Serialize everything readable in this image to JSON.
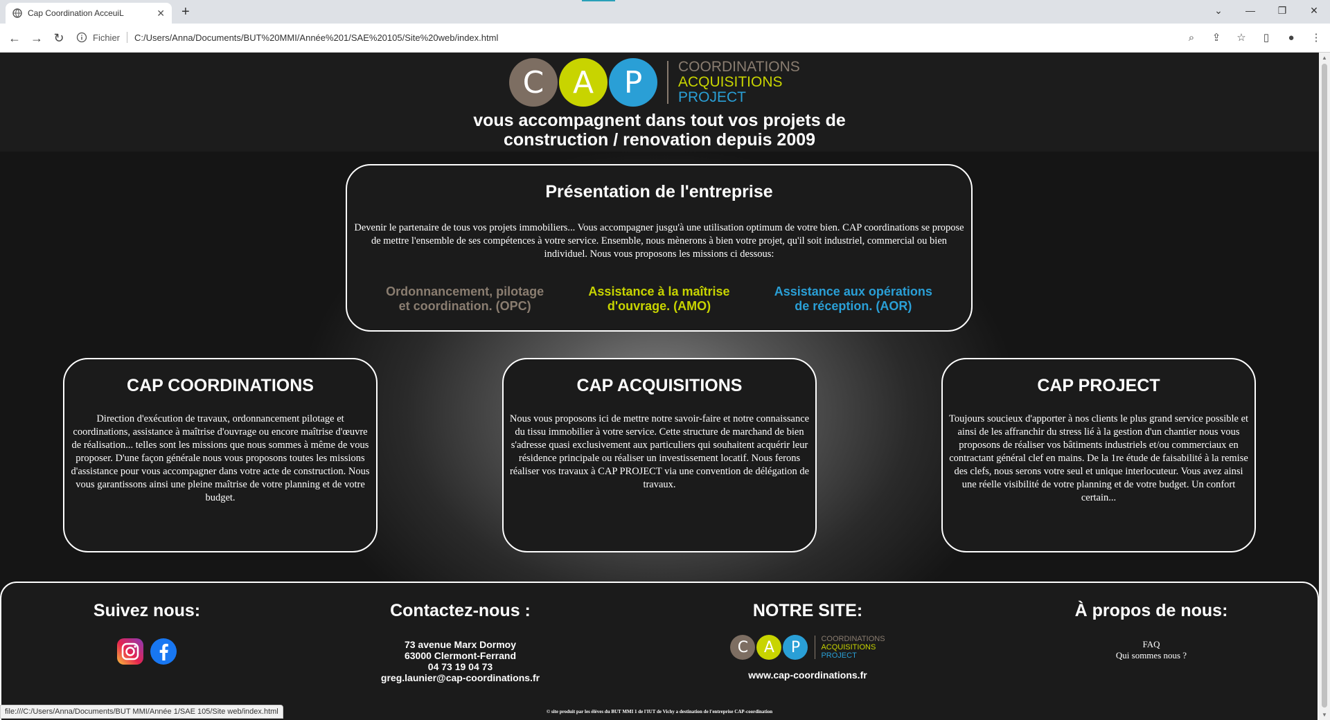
{
  "browser": {
    "tab_title": "Cap Coordination AcceuiL",
    "new_tab": "+",
    "url_scheme": "Fichier",
    "url": "C:/Users/Anna/Documents/BUT%20MMI/Année%201/SAE%20105/Site%20web/index.html",
    "status_url": "file:///C:/Users/Anna/Documents/BUT MMI/Année 1/SAE 105/Site web/index.html"
  },
  "header": {
    "logo_letters": [
      "C",
      "A",
      "P"
    ],
    "logo_words": [
      "COORDINATIONS",
      "ACQUISITIONS",
      "PROJECT"
    ],
    "tagline_line1": "vous accompagnent dans tout vos projets de",
    "tagline_line2": "construction / renovation depuis 2009"
  },
  "presentation": {
    "title": "Présentation de l'entreprise",
    "text": "Devenir le partenaire de tous vos projets immobiliers... Vous accompagner jusgu'à une utilisation optimum de votre bien. CAP coordinations se propose de mettre l'ensemble de ses compétences à votre service. Ensemble, nous mènerons à bien votre projet, qu'il soit industriel, commercial ou bien individuel. Nous vous proposons les missions ci dessous:",
    "missions": [
      "Ordonnancement, pilotage et coordination. (OPC)",
      "Assistance à la maîtrise d'ouvrage. (AMO)",
      "Assistance aux opérations de réception. (AOR)"
    ]
  },
  "cards": [
    {
      "title": "CAP COORDINATIONS",
      "text": "Direction d'exécution de travaux, ordonnancement pilotage et coordinations, assistance à maîtrise d'ouvrage ou encore maîtrise d'œuvre de réalisation... telles sont les missions que nous sommes à même de vous proposer. D'une façon générale nous vous proposons toutes les missions d'assistance pour vous accompagner dans votre acte de construction. Nous vous garantissons ainsi une pleine maîtrise de votre planning et de votre budget."
    },
    {
      "title": "CAP ACQUISITIONS",
      "text": "Nous vous proposons ici de mettre notre savoir-faire et notre connaissance du tissu immobilier à votre service. Cette structure de marchand de bien s'adresse quasi exclusivement aux particuliers qui souhaitent acquérir leur résidence principale ou réaliser un investissement locatif. Nous ferons réaliser vos travaux à CAP PROJECT via une convention de délégation de travaux."
    },
    {
      "title": "CAP PROJECT",
      "text": "Toujours soucieux d'apporter à nos clients le plus grand service possible et ainsi de les affranchir du stress lié à la gestion d'un chantier nous vous proposons de réaliser vos bâtiments industriels et/ou commerciaux en contractant général clef en mains. De la 1re étude de faisabilité à la remise des clefs, nous serons votre seul et unique interlocuteur. Vous avez ainsi une réelle visibilité de votre planning et de votre budget. Un confort certain..."
    }
  ],
  "footer": {
    "follow_title": "Suivez nous:",
    "contact_title": "Contactez-nous :",
    "contact_lines": [
      "73 avenue Marx Dormoy",
      "63000 Clermont-Ferrand",
      "04 73 19 04 73",
      "greg.launier@cap-coordinations.fr"
    ],
    "site_title": "NOTRE SITE:",
    "site_url": "www.cap-coordinations.fr",
    "about_title": "À propos de nous:",
    "about_links": [
      "FAQ",
      "Qui sommes nous ?"
    ],
    "copyright": "© site produit par les élèves du BUT MMI 1 de l'IUT de Vichy a destination de l'entreprise CAP-coordination"
  },
  "colors": {
    "brand_brown": "#7d6e62",
    "brand_yellow": "#c8d400",
    "brand_blue": "#2a9fd6",
    "opc_text": "#8a7d70",
    "amo_text": "#c8d400",
    "aor_text": "#2a9fd6"
  }
}
